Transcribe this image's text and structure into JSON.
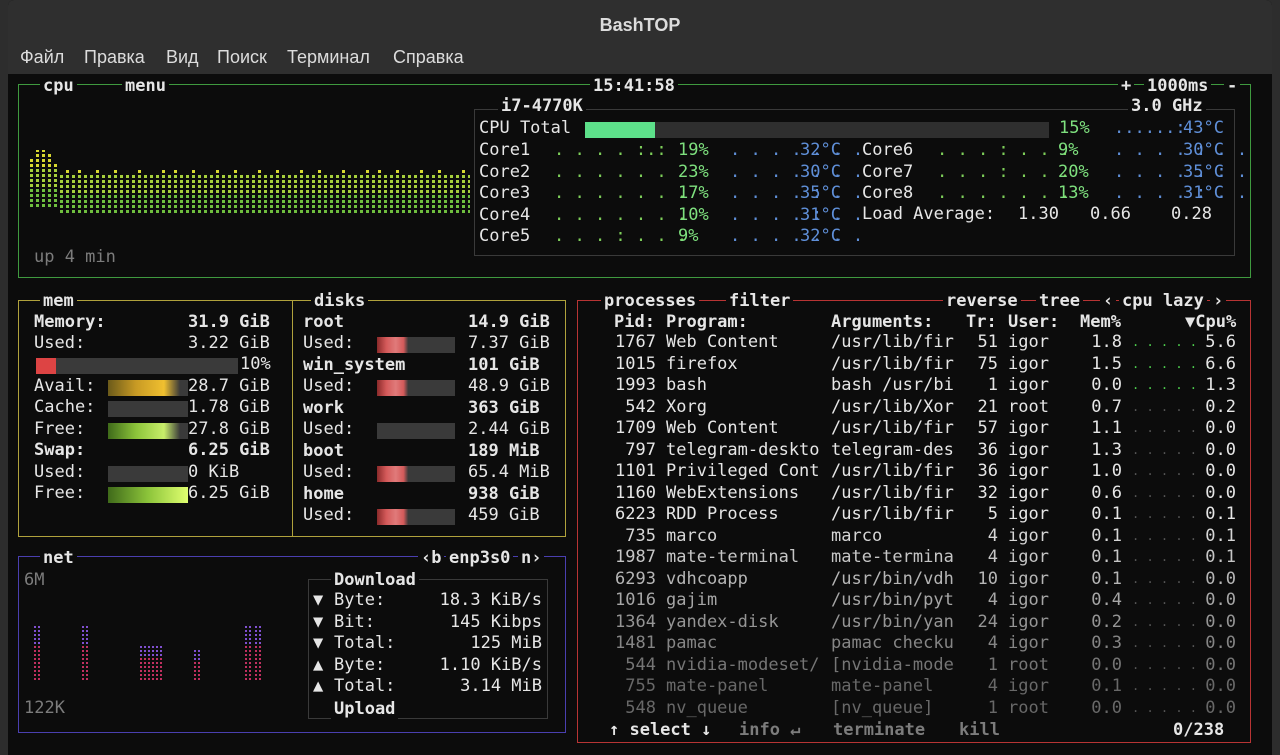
{
  "window": {
    "title": "BashTOP"
  },
  "menu": [
    "Файл",
    "Правка",
    "Вид",
    "Поиск",
    "Терминал",
    "Справка"
  ],
  "cpu": {
    "box_label": "cpu",
    "menu_label": "menu",
    "clock": "15:41:58",
    "refresh_plus": "+",
    "refresh": "1000ms",
    "refresh_minus": "-",
    "model": "i7-4770K",
    "freq": "3.0 GHz",
    "uptime": "up 4 min",
    "total": {
      "label": "CPU Total",
      "pct": "15%",
      "pct_value": 15,
      "temp": "43°C",
      "graph": "......:"
    },
    "cores": [
      {
        "name": "Core1",
        "pct": "19%",
        "temp": "32°C",
        "graph": ". . . . :.:"
      },
      {
        "name": "Core2",
        "pct": "23%",
        "temp": "30°C",
        "graph": ". . . . . ."
      },
      {
        "name": "Core3",
        "pct": "17%",
        "temp": "35°C",
        "graph": ". . . . . . ."
      },
      {
        "name": "Core4",
        "pct": "10%",
        "temp": "31°C",
        "graph": ". . . . . . ."
      },
      {
        "name": "Core5",
        "pct": "9%",
        "temp": "32°C",
        "graph": ". . . : . . ."
      },
      {
        "name": "Core6",
        "pct": "9%",
        "temp": "30°C",
        "graph": ". . . : . . ."
      },
      {
        "name": "Core7",
        "pct": "20%",
        "temp": "35°C",
        "graph": ". . . : . . ."
      },
      {
        "name": "Core8",
        "pct": "13%",
        "temp": "31°C",
        "graph": ". . . . . . ."
      }
    ],
    "temp_graphs": [
      ". . . . . . .",
      ". . . . . . .",
      ". . . . : . .",
      ". . . . : . .",
      ". . . . . . .",
      ". . . . : . .",
      ". . . . . : .",
      ". . . . : . ."
    ],
    "load_label": "Load Average:",
    "load": [
      "1.30",
      "0.66",
      "0.28"
    ],
    "accent": "#6fbf3f"
  },
  "mem": {
    "box_label": "mem",
    "memory_label": "Memory:",
    "memory_total": "31.9 GiB",
    "rows": [
      {
        "label": "Used:",
        "value": "3.22 GiB"
      },
      {
        "label": "",
        "value": "10%"
      },
      {
        "label": "Avail:",
        "value": "28.7 GiB"
      },
      {
        "label": "Cache:",
        "value": "1.78 GiB"
      },
      {
        "label": "Free:",
        "value": "27.8 GiB"
      }
    ],
    "swap_label": "Swap:",
    "swap_total": "6.25 GiB",
    "swap_rows": [
      {
        "label": "Used:",
        "value": "0 KiB"
      },
      {
        "label": "Free:",
        "value": "6.25 GiB"
      }
    ]
  },
  "disks": {
    "box_label": "disks",
    "items": [
      {
        "name": "root",
        "total": "14.9 GiB",
        "used_label": "Used:",
        "used": "7.37 GiB"
      },
      {
        "name": "win_system",
        "total": "101 GiB",
        "used_label": "Used:",
        "used": "48.9 GiB"
      },
      {
        "name": "work",
        "total": "363 GiB",
        "used_label": "Used:",
        "used": "2.44 GiB"
      },
      {
        "name": "boot",
        "total": "189 MiB",
        "used_label": "Used:",
        "used": "65.4 MiB"
      },
      {
        "name": "home",
        "total": "938 GiB",
        "used_label": "Used:",
        "used": "459 GiB"
      }
    ]
  },
  "net": {
    "box_label": "net",
    "iface_prev": "‹b",
    "iface": "enp3s0",
    "iface_next": "n›",
    "scale_top": "6M",
    "scale_bottom": "122K",
    "download_label": "Download",
    "upload_label": "Upload",
    "rows": [
      {
        "arrow": "▼",
        "label": "Byte:",
        "value": "18.3 KiB/s"
      },
      {
        "arrow": "▼",
        "label": "Bit:",
        "value": "145 Kibps"
      },
      {
        "arrow": "▼",
        "label": "Total:",
        "value": "125 MiB"
      },
      {
        "arrow": "▲",
        "label": "Byte:",
        "value": "1.10 KiB/s"
      },
      {
        "arrow": "▲",
        "label": "Total:",
        "value": "3.14 MiB"
      }
    ]
  },
  "proc": {
    "box_label": "processes",
    "filter_label": "filter",
    "reverse_label": "reverse",
    "tree_label": "tree",
    "sort_prev": "‹",
    "sort_label": "cpu lazy",
    "sort_next": "›",
    "headers": {
      "pid": "Pid:",
      "program": "Program:",
      "args": "Arguments:",
      "threads": "Tr:",
      "user": "User:",
      "mem": "Mem%",
      "cpu": "▼Cpu%"
    },
    "rows": [
      {
        "pid": "1767",
        "program": "Web Content",
        "args": "/usr/lib/fir",
        "threads": "51",
        "user": "igor",
        "mem": "1.8",
        "graph": ". . . . .",
        "cpu": "5.6"
      },
      {
        "pid": "1015",
        "program": "firefox",
        "args": "/usr/lib/fir",
        "threads": "75",
        "user": "igor",
        "mem": "1.5",
        "graph": ". . . . . .",
        "cpu": "6.6"
      },
      {
        "pid": "1993",
        "program": "bash",
        "args": "bash /usr/bi",
        "threads": "1",
        "user": "igor",
        "mem": "0.0",
        "graph": ". . . . .",
        "cpu": "1.3"
      },
      {
        "pid": "542",
        "program": "Xorg",
        "args": "/usr/lib/Xor",
        "threads": "21",
        "user": "root",
        "mem": "0.7",
        "graph": ". . . . .",
        "cpu": "0.2"
      },
      {
        "pid": "1709",
        "program": "Web Content",
        "args": "/usr/lib/fir",
        "threads": "57",
        "user": "igor",
        "mem": "1.1",
        "graph": ". . . . .",
        "cpu": "0.0"
      },
      {
        "pid": "797",
        "program": "telegram-deskto",
        "args": "telegram-des",
        "threads": "36",
        "user": "igor",
        "mem": "1.3",
        "graph": ". . . . .",
        "cpu": "0.0"
      },
      {
        "pid": "1101",
        "program": "Privileged Cont",
        "args": "/usr/lib/fir",
        "threads": "36",
        "user": "igor",
        "mem": "1.0",
        "graph": ". . . . .",
        "cpu": "0.0"
      },
      {
        "pid": "1160",
        "program": "WebExtensions",
        "args": "/usr/lib/fir",
        "threads": "32",
        "user": "igor",
        "mem": "0.6",
        "graph": ". . . . .",
        "cpu": "0.0"
      },
      {
        "pid": "6223",
        "program": "RDD Process",
        "args": "/usr/lib/fir",
        "threads": "5",
        "user": "igor",
        "mem": "0.1",
        "graph": ". . . . .",
        "cpu": "0.1"
      },
      {
        "pid": "735",
        "program": "marco",
        "args": "marco",
        "threads": "4",
        "user": "igor",
        "mem": "0.1",
        "graph": ". . . . .",
        "cpu": "0.1"
      },
      {
        "pid": "1987",
        "program": "mate-terminal",
        "args": "mate-termina",
        "threads": "4",
        "user": "igor",
        "mem": "0.1",
        "graph": ". . . . .",
        "cpu": "0.1"
      },
      {
        "pid": "6293",
        "program": "vdhcoapp",
        "args": "/usr/bin/vdh",
        "threads": "10",
        "user": "igor",
        "mem": "0.1",
        "graph": ". . . . .",
        "cpu": "0.0"
      },
      {
        "pid": "1016",
        "program": "gajim",
        "args": "/usr/bin/pyt",
        "threads": "4",
        "user": "igor",
        "mem": "0.4",
        "graph": ". . . . .",
        "cpu": "0.0"
      },
      {
        "pid": "1364",
        "program": "yandex-disk",
        "args": "/usr/bin/yan",
        "threads": "24",
        "user": "igor",
        "mem": "0.2",
        "graph": ". . . . .",
        "cpu": "0.0"
      },
      {
        "pid": "1481",
        "program": "pamac",
        "args": "pamac checku",
        "threads": "4",
        "user": "igor",
        "mem": "0.3",
        "graph": ". . . . .",
        "cpu": "0.0"
      },
      {
        "pid": "544",
        "program": "nvidia-modeset/",
        "args": "[nvidia-mode",
        "threads": "1",
        "user": "root",
        "mem": "0.0",
        "graph": ". . . . .",
        "cpu": "0.0"
      },
      {
        "pid": "755",
        "program": "mate-panel",
        "args": "mate-panel",
        "threads": "4",
        "user": "igor",
        "mem": "0.1",
        "graph": ". . . . .",
        "cpu": "0.0"
      },
      {
        "pid": "548",
        "program": "nv_queue",
        "args": "[nv_queue]",
        "threads": "1",
        "user": "root",
        "mem": "0.0",
        "graph": ". . . . .",
        "cpu": "0.0"
      }
    ],
    "footer": {
      "select": "↑ select ↓",
      "info": "info ↵",
      "terminate": "terminate",
      "kill": "kill",
      "count": "0/238"
    }
  }
}
